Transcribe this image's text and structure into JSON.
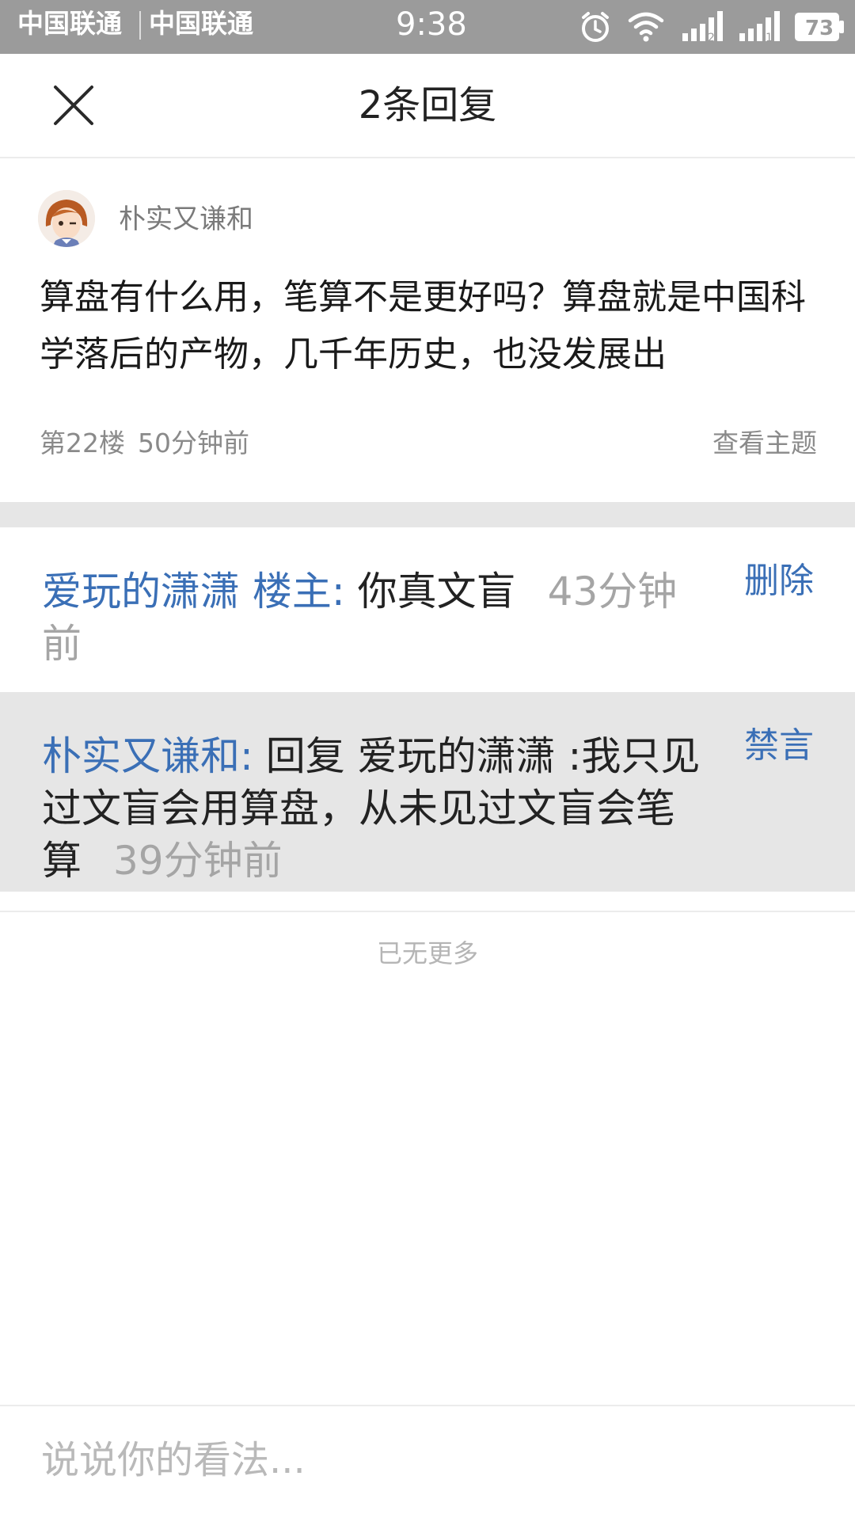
{
  "status_bar": {
    "carrier_1": "中国联通",
    "carrier_2": "中国联通",
    "time": "9:38",
    "battery": "73",
    "icons": [
      "alarm-icon",
      "wifi-icon",
      "signal-icon",
      "signal-icon",
      "battery-icon"
    ]
  },
  "header": {
    "title": "2条回复",
    "close_icon": "close-icon"
  },
  "post": {
    "author": "朴实又谦和",
    "body": "算盘有什么用，笔算不是更好吗？算盘就是中国科学落后的产物，几千年历史，也没发展出",
    "floor": "第22楼",
    "time": "50分钟前",
    "view_topic": "查看主题"
  },
  "replies": [
    {
      "name": "爱玩的潇潇",
      "badge": "楼主",
      "separator": ":",
      "content": "你真文盲",
      "time": "43分钟前",
      "action": "删除"
    },
    {
      "name": "朴实又谦和",
      "separator": ":",
      "content": "回复 爱玩的潇潇 :我只见过文盲会用算盘，从未见过文盲会笔算",
      "time": "39分钟前",
      "action": "禁言"
    }
  ],
  "footer": {
    "no_more": "已无更多"
  },
  "comment_box": {
    "placeholder": "说说你的看法..."
  },
  "colors": {
    "status_bar_bg": "#9b9b9b",
    "link_blue": "#3a6fb6",
    "highlight_bg": "#e6e6e6"
  }
}
